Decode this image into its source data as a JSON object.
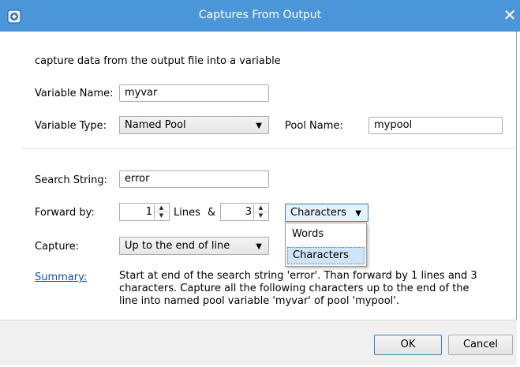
{
  "window": {
    "title": "Captures From Output"
  },
  "intro": "capture data from the output file into a variable",
  "variable_name": {
    "label": "Variable Name:",
    "value": "myvar"
  },
  "variable_type": {
    "label": "Variable Type:",
    "value": "Named Pool"
  },
  "pool_name": {
    "label": "Pool Name:",
    "value": "mypool"
  },
  "search_string": {
    "label": "Search String:",
    "value": "error"
  },
  "forward": {
    "label": "Forward by:",
    "lines_value": "1",
    "lines_label": "Lines",
    "ampersand": "&",
    "chars_value": "3",
    "unit_value": "Characters",
    "unit_options": [
      "Words",
      "Characters"
    ]
  },
  "capture": {
    "label": "Capture:",
    "value": "Up to the end of line"
  },
  "summary": {
    "link": "Summary:",
    "text": "Start at end of the search string 'error'. Than forward by 1 lines and 3 characters. Capture all the following characters up to the end of the line into named pool variable 'myvar' of pool 'mypool'."
  },
  "buttons": {
    "ok": "OK",
    "cancel": "Cancel"
  },
  "colors": {
    "titlebar": "#4a96d9",
    "link": "#0b4fb5",
    "selection": "#cde3f7"
  }
}
